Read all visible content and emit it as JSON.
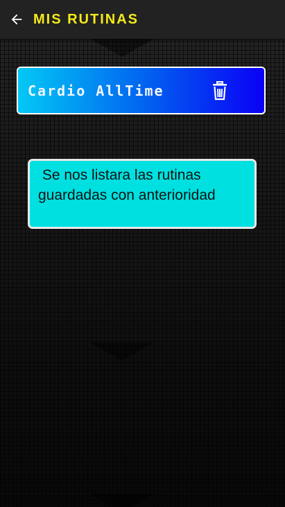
{
  "app_bar": {
    "back_icon": "arrow-left-icon",
    "title": "MIS RUTINAS",
    "title_color": "#f4ea1a"
  },
  "routines": [
    {
      "name": "Cardio AllTime",
      "delete_icon": "trash-icon"
    }
  ],
  "info_message": " Se nos listara las rutinas guardadas con anterioridad",
  "colors": {
    "card_gradient_start": "#03c8f5",
    "card_gradient_end": "#0a00f5",
    "info_background": "#00e0e0"
  }
}
